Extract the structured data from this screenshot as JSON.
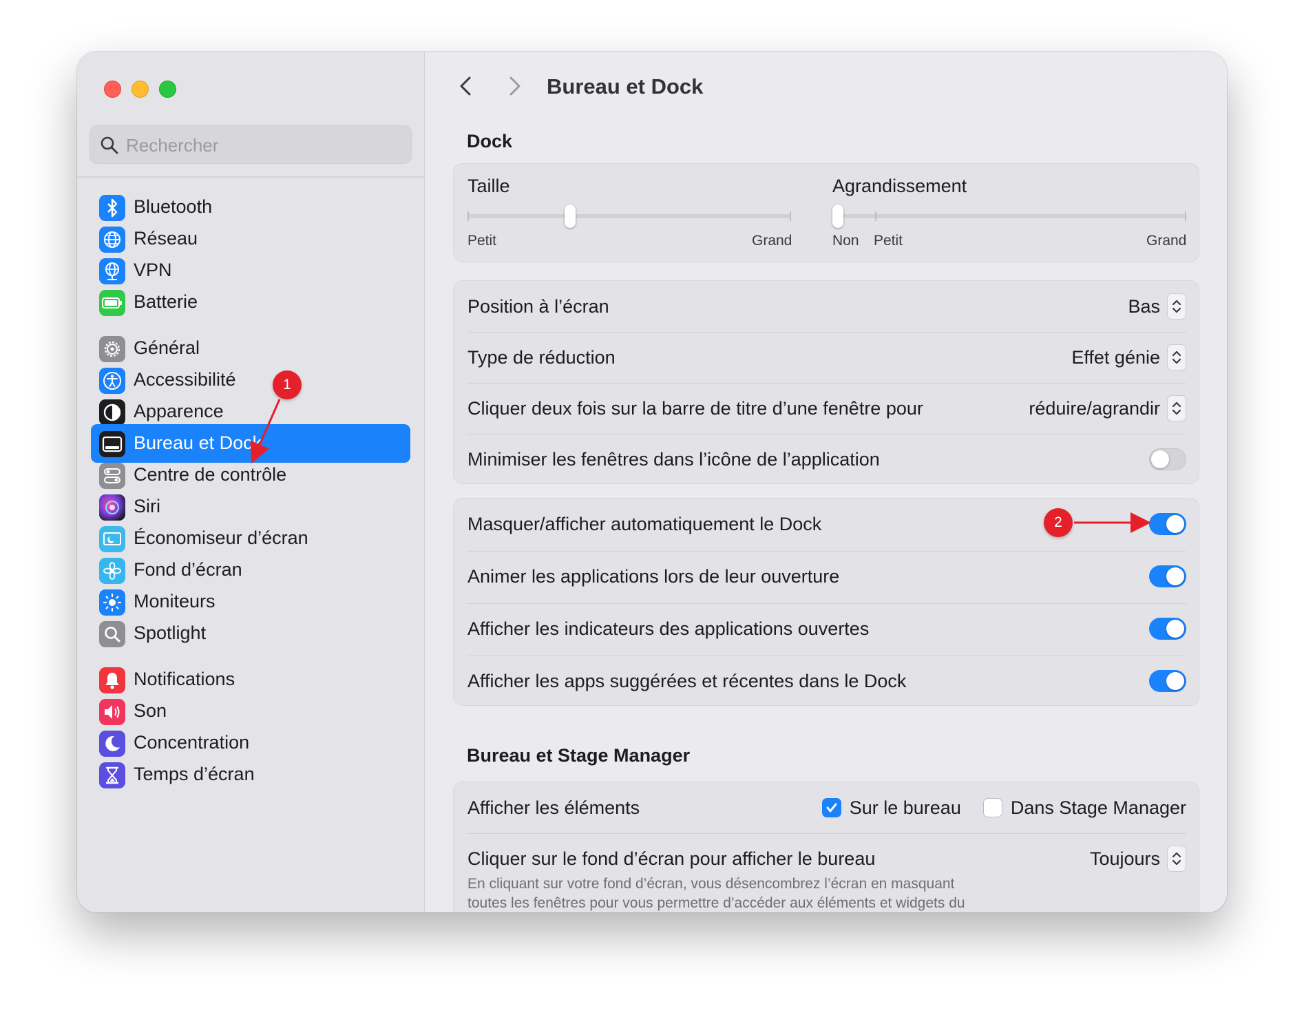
{
  "window": {
    "search_placeholder": "Rechercher"
  },
  "sidebar": {
    "items": [
      {
        "label": "Bluetooth",
        "icon": "bluetooth-icon",
        "color": "#1a82fb",
        "active": false
      },
      {
        "label": "Réseau",
        "icon": "globe-icon",
        "color": "#1a82fb",
        "active": false
      },
      {
        "label": "VPN",
        "icon": "vpn-globe-icon",
        "color": "#1a82fb",
        "active": false
      },
      {
        "label": "Batterie",
        "icon": "battery-icon",
        "color": "#30c94a",
        "active": false
      },
      {
        "label": "Général",
        "icon": "gear-icon",
        "color": "#8e8e93",
        "active": false
      },
      {
        "label": "Accessibilité",
        "icon": "accessibility-icon",
        "color": "#1a82fb",
        "active": false
      },
      {
        "label": "Apparence",
        "icon": "appearance-icon",
        "color": "#1d1d1f",
        "active": false
      },
      {
        "label": "Bureau et Dock",
        "icon": "dock-icon",
        "color": "#1d1d1f",
        "active": true
      },
      {
        "label": "Centre de contrôle",
        "icon": "control-center-icon",
        "color": "#8e8e93",
        "active": false
      },
      {
        "label": "Siri",
        "icon": "siri-icon",
        "color": "#7a3cd8",
        "active": false
      },
      {
        "label": "Économiseur d’écran",
        "icon": "screensaver-icon",
        "color": "#3bb8ec",
        "active": false
      },
      {
        "label": "Fond d’écran",
        "icon": "wallpaper-icon",
        "color": "#36b6ee",
        "active": false
      },
      {
        "label": "Moniteurs",
        "icon": "sun-icon",
        "color": "#1a82fb",
        "active": false
      },
      {
        "label": "Spotlight",
        "icon": "spotlight-icon",
        "color": "#8e8e93",
        "active": false
      },
      {
        "label": "Notifications",
        "icon": "bell-icon",
        "color": "#f0353e",
        "active": false
      },
      {
        "label": "Son",
        "icon": "speaker-icon",
        "color": "#f0355f",
        "active": false
      },
      {
        "label": "Concentration",
        "icon": "moon-icon",
        "color": "#5b4fe0",
        "active": false
      },
      {
        "label": "Temps d’écran",
        "icon": "hourglass-icon",
        "color": "#5b4fe0",
        "active": false
      }
    ]
  },
  "main": {
    "title": "Bureau et Dock",
    "dock_section_title": "Dock",
    "size_slider": {
      "label": "Taille",
      "min_label": "Petit",
      "max_label": "Grand",
      "value": 0.31
    },
    "magnification_slider": {
      "label": "Agrandissement",
      "off_label": "Non",
      "min_label": "Petit",
      "max_label": "Grand",
      "value": 0.0
    },
    "settings_rows": [
      {
        "label": "Position à l’écran",
        "value": "Bas"
      },
      {
        "label": "Type de réduction",
        "value": "Effet génie"
      },
      {
        "label": "Cliquer deux fois sur la barre de titre d’une fenêtre pour",
        "value": "réduire/agrandir"
      },
      {
        "label": "Minimiser les fenêtres dans l’icône de l’application",
        "toggle": false
      }
    ],
    "toggle_rows": [
      {
        "label": "Masquer/afficher automatiquement le Dock",
        "toggle": true
      },
      {
        "label": "Animer les applications lors de leur ouverture",
        "toggle": true
      },
      {
        "label": "Afficher les indicateurs des applications ouvertes",
        "toggle": true
      },
      {
        "label": "Afficher les apps suggérées et récentes dans le Dock",
        "toggle": true
      }
    ],
    "stage_section_title": "Bureau et Stage Manager",
    "show_items": {
      "label": "Afficher les éléments",
      "desktop_label": "Sur le bureau",
      "desktop_checked": true,
      "stage_label": "Dans Stage Manager",
      "stage_checked": false
    },
    "click_wallpaper": {
      "label": "Cliquer sur le fond d’écran pour afficher le bureau",
      "value": "Toujours",
      "description_line1": "En cliquant sur votre fond d’écran, vous désencombrez l’écran en masquant",
      "description_line2": "toutes les fenêtres pour vous permettre d’accéder aux éléments et widgets du"
    }
  },
  "annotations": {
    "badge1": "1",
    "badge2": "2",
    "color": "#e5202a"
  },
  "colors": {
    "accent": "#1a82fb",
    "window_bg": "#ebebef",
    "sidebar_bg": "#e4e4e8"
  }
}
